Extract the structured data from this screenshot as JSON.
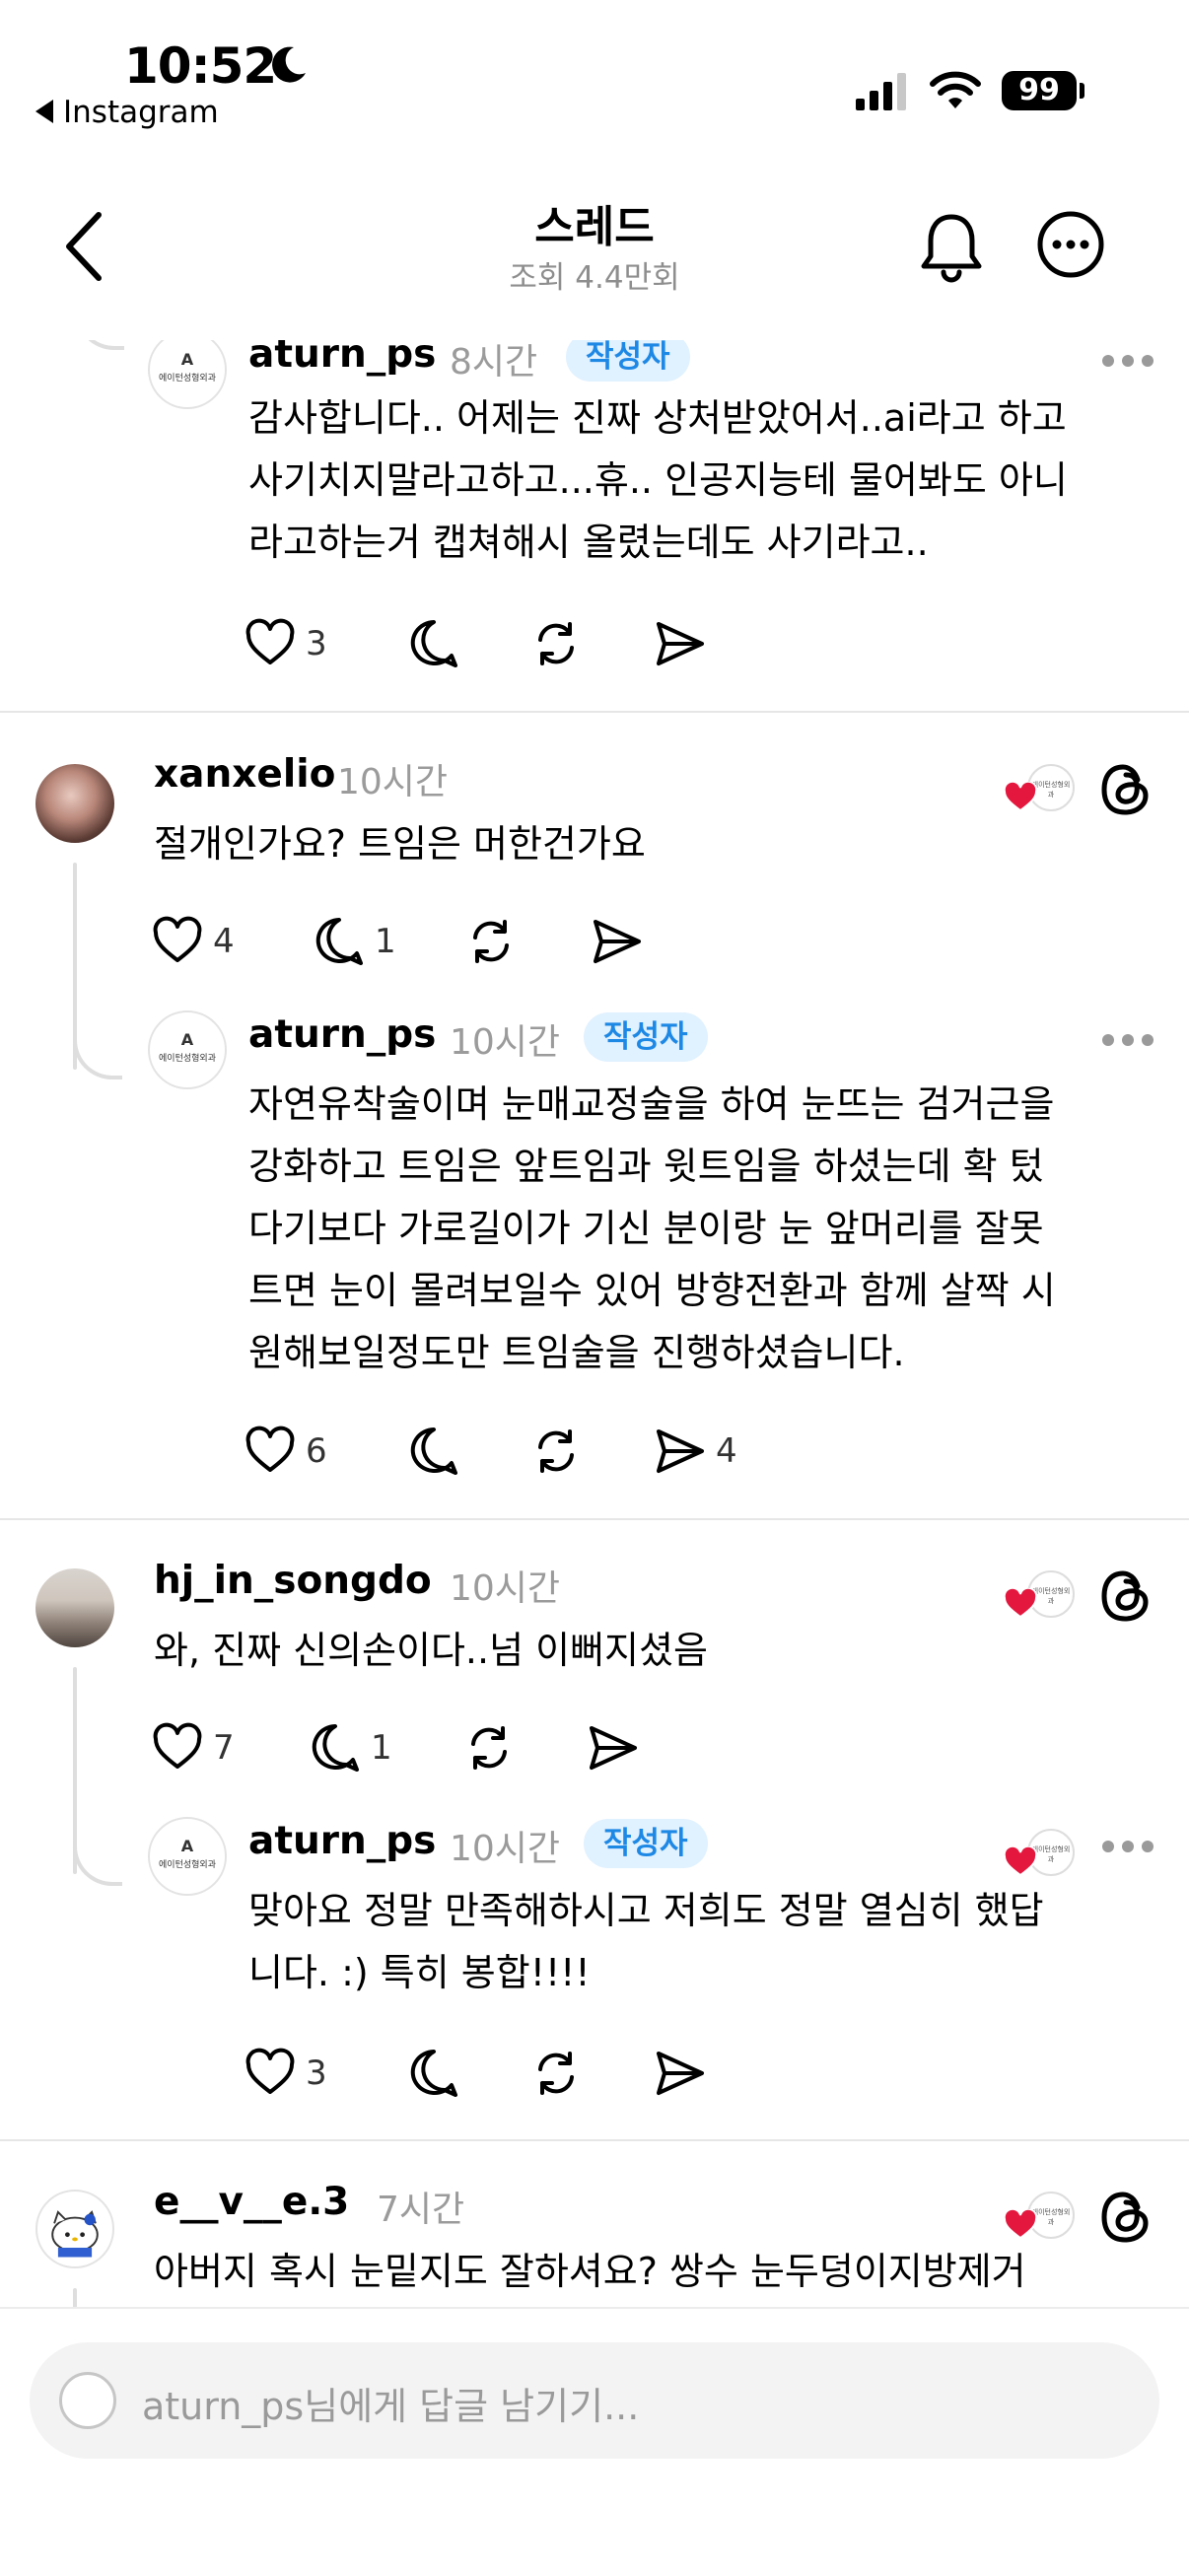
{
  "status_bar": {
    "time": "10:52",
    "back_app": "Instagram",
    "battery": "99"
  },
  "header": {
    "title": "스레드",
    "views": "조회 4.4만회"
  },
  "colors": {
    "heart": "#e4173e",
    "badge_bg": "#e0f1ff",
    "badge_text": "#1e88e5"
  },
  "posts": [
    {
      "username": "aturn_ps",
      "time": "8시간",
      "badge": "작성자",
      "lines": [
        "감사합니다.. 어제는 진짜 상처받았어서..ai라고 하고",
        "사기치지말라고하고...휴.. 인공지능테 물어봐도 아니",
        "라고하는거 캡쳐해시 올렸는데도 사기라고.."
      ],
      "likes": "3"
    },
    {
      "username": "xanxelio",
      "time": "10시간",
      "lines": [
        "절개인가요? 트임은 머한건가요"
      ],
      "likes": "4",
      "replies": "1"
    },
    {
      "username": "aturn_ps",
      "time": "10시간",
      "badge": "작성자",
      "lines": [
        "자연유착술이며 눈매교정술을 하여 눈뜨는 검거근을",
        "강화하고 트임은 앞트임과 윗트임을 하셨는데 확 텄",
        "다기보다 가로길이가 기신 분이랑 눈 앞머리를 잘못",
        "트면 눈이 몰려보일수 있어 방향전환과 함께 살짝 시",
        "원해보일정도만 트임술을 진행하셨습니다."
      ],
      "likes": "6",
      "shares": "4"
    },
    {
      "username": "hj_in_songdo",
      "time": "10시간",
      "lines": [
        "와, 진짜 신의손이다..넘 이뻐지셨음"
      ],
      "likes": "7",
      "replies": "1"
    },
    {
      "username": "aturn_ps",
      "time": "10시간",
      "badge": "작성자",
      "lines": [
        "맞아요 정말 만족해하시고 저희도 정말 열심히 했답",
        "니다. :) 특히 봉합!!!!"
      ],
      "likes": "3"
    },
    {
      "username": "e__v__e.3",
      "time": "7시간",
      "lines": [
        "아버지 혹시 눈밑지도 잘하셔요? 쌍수 눈두덩이지방제거"
      ]
    }
  ],
  "clinic_logo": {
    "mark": "A",
    "text": "에이턴성형외과"
  },
  "reply_bar": {
    "placeholder": "aturn_ps님에게 답글 남기기..."
  }
}
